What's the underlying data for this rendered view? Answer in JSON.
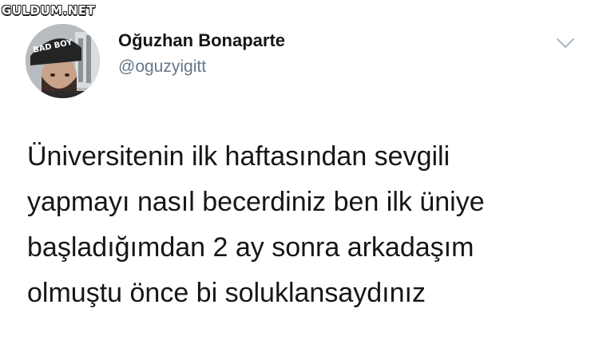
{
  "watermark": "GULDUM.NET",
  "author": {
    "display_name": "Oğuzhan Bonaparte",
    "handle": "@oguzyigitt",
    "avatar_cap_text": "BAD BOY"
  },
  "menu_icon": "chevron-down-icon",
  "tweet": {
    "lines": [
      "Üniversitenin ilk haftasından sevgili",
      "yapmayı nasıl becerdiniz ben ilk üniye",
      "başladığımdan 2 ay sonra arkadaşım",
      "olmuştu önce bi soluklansaydınız"
    ]
  }
}
